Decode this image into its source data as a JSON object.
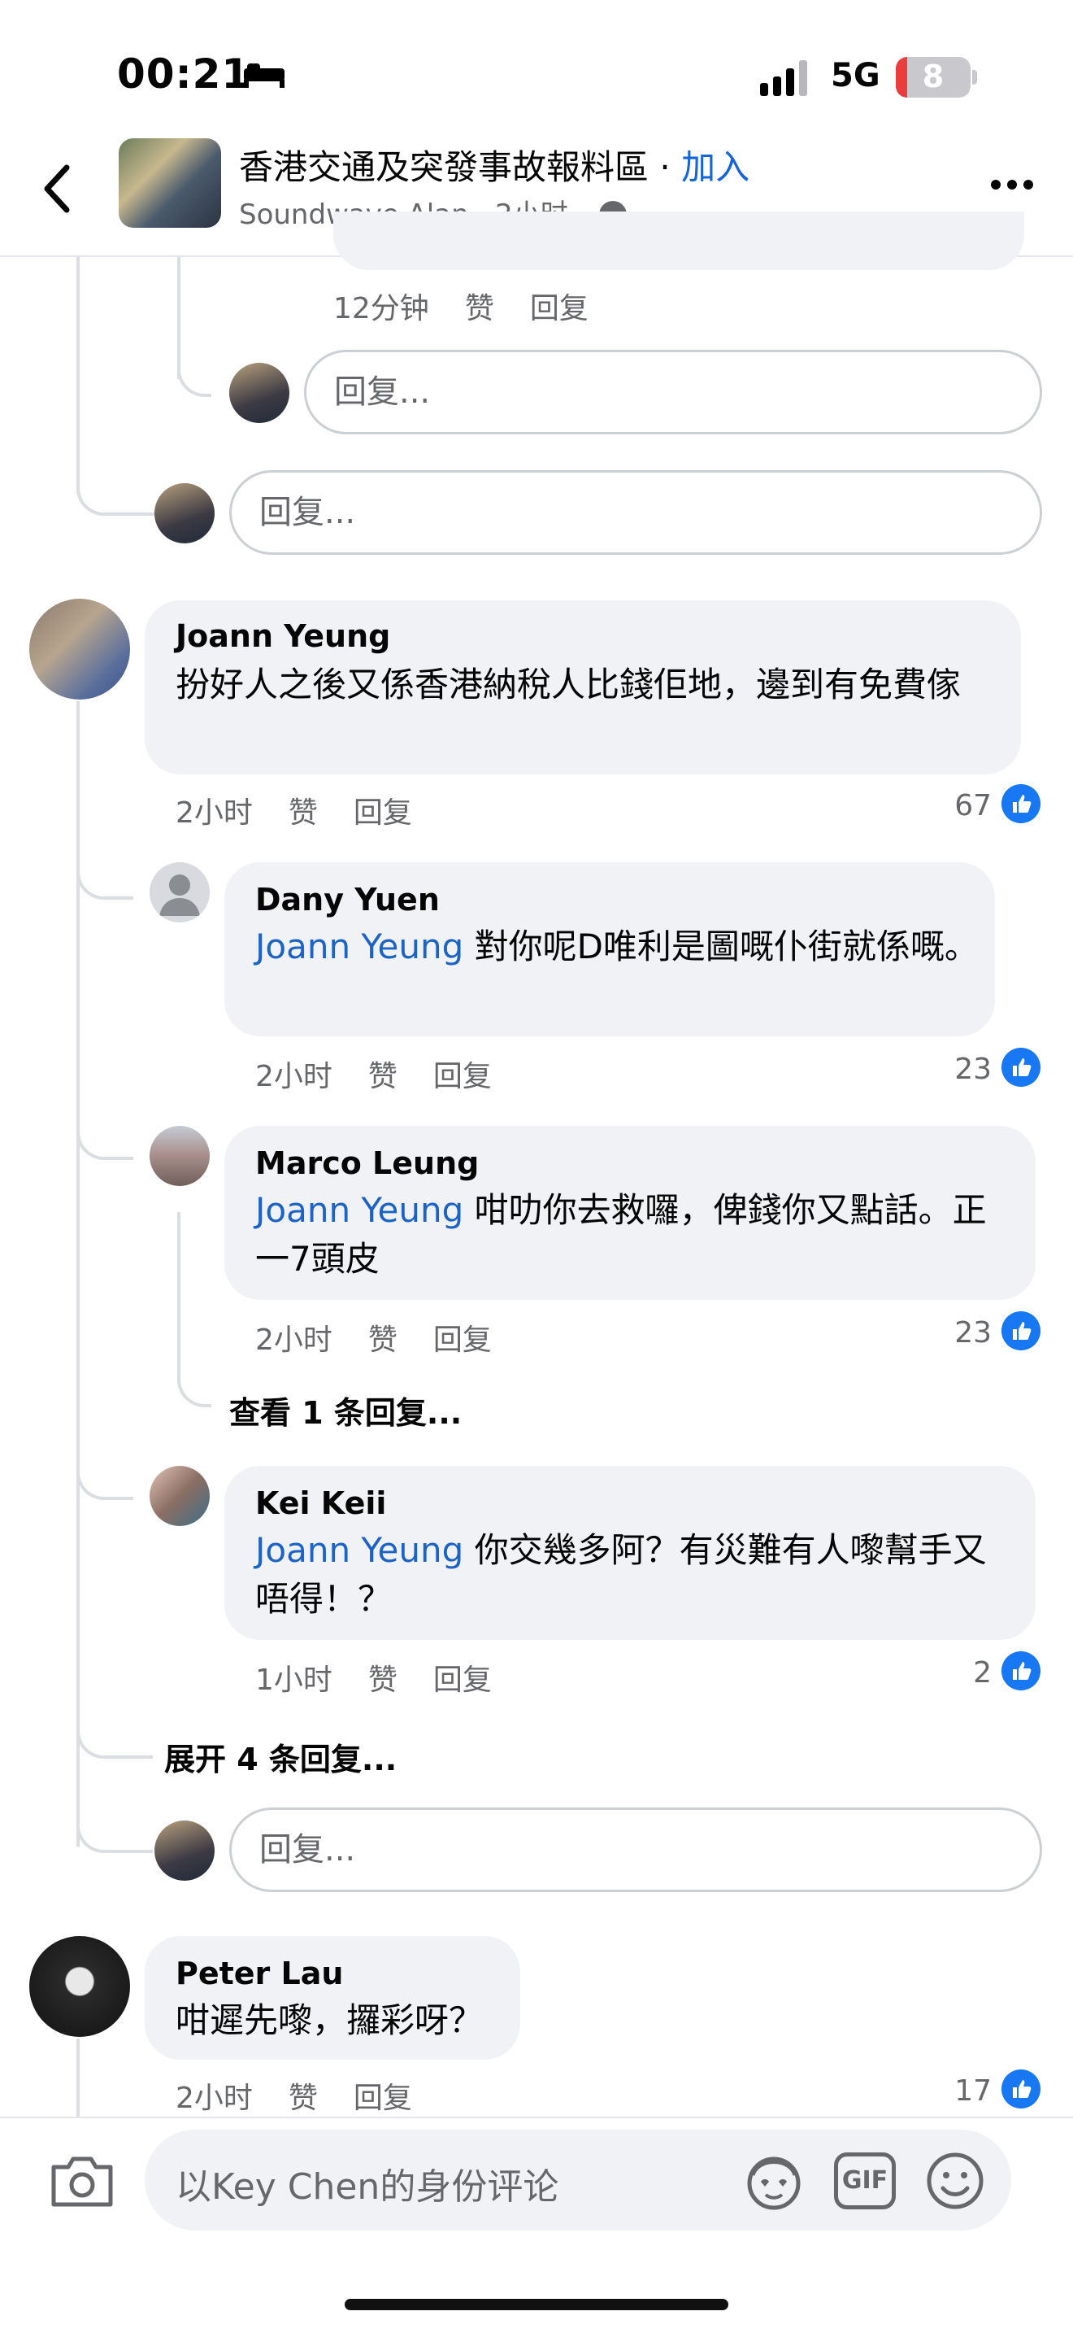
{
  "status": {
    "time": "00:21",
    "network": "5G",
    "battery": "8"
  },
  "header": {
    "group_name": "香港交通及突發事故報料區",
    "join_sep": " · ",
    "join_label": "加入",
    "author": "Soundwave Alan",
    "time": " · 2小时 · "
  },
  "thread_top": {
    "meta_time": "12分钟",
    "like_label": "赞",
    "reply_label": "回复",
    "reply_placeholder_1": "回复...",
    "reply_placeholder_2": "回复..."
  },
  "comments": [
    {
      "name": "Joann Yeung",
      "text": "扮好人之後又係香港納稅人比錢佢地，邊到有免費傢",
      "time": "2小时",
      "like": "赞",
      "reply": "回复",
      "likes": "67",
      "replies": [
        {
          "name": "Dany Yuen",
          "tag": "Joann Yeung",
          "text": " 對你呢D唯利是圖嘅仆街就係嘅。",
          "time": "2小时",
          "like": "赞",
          "reply": "回复",
          "likes": "23"
        },
        {
          "name": "Marco Leung",
          "tag": "Joann Yeung",
          "text": " 咁叻你去救囉，俾錢你又點話。正一7頭皮",
          "time": "2小时",
          "like": "赞",
          "reply": "回复",
          "likes": "23",
          "view_more": "查看 1 条回复..."
        },
        {
          "name": "Kei Keii",
          "tag": "Joann Yeung",
          "text": " 你交幾多阿？有災難有人嚟幫手又唔得！？",
          "time": "1小时",
          "like": "赞",
          "reply": "回复",
          "likes": "2"
        }
      ],
      "expand_more": "展开 4 条回复...",
      "reply_placeholder": "回复..."
    },
    {
      "name": "Peter Lau",
      "text": "咁遲先嚟，攞彩呀？",
      "time": "2小时",
      "like": "赞",
      "reply": "回复",
      "likes": "17"
    }
  ],
  "composer": {
    "placeholder": "以Key Chen的身份评论",
    "gif_label": "GIF"
  },
  "icons": [
    "back-icon",
    "more-icon",
    "globe-icon",
    "camera-icon",
    "avatar-sticker-icon",
    "gif-icon",
    "emoji-icon",
    "like-icon"
  ],
  "colors": {
    "accent": "#1877f2",
    "link": "#1b63c6",
    "bubble": "#f0f2f5",
    "meta": "#65676b"
  }
}
